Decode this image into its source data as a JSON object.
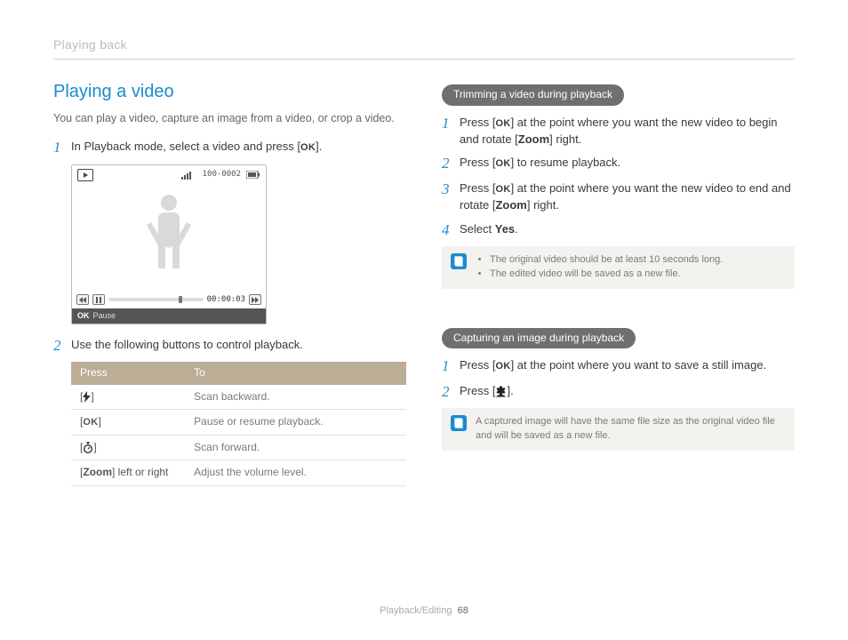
{
  "header": {
    "breadcrumb": "Playing back"
  },
  "left": {
    "title": "Playing a video",
    "lead": "You can play a video, capture an image from a video, or crop a video.",
    "step1_pre": "In Playback mode, select a video and press [",
    "step1_post": "].",
    "screenshot": {
      "top_counter": "100-0002",
      "timecode": "00:00:03",
      "footer_ok": "OK",
      "footer_label": "Pause"
    },
    "step2": "Use the following buttons to control playback.",
    "table": {
      "headers": [
        "Press",
        "To"
      ],
      "rows": [
        {
          "press_open": "[",
          "press_icon": "flash",
          "press_close": "]",
          "to": "Scan backward."
        },
        {
          "press_open": "[",
          "press_icon": "ok",
          "press_close": "]",
          "to": "Pause or resume playback."
        },
        {
          "press_open": "[",
          "press_icon": "timer",
          "press_close": "]",
          "to": "Scan forward."
        },
        {
          "press_plain": "[Zoom] left or right",
          "to": "Adjust the volume level."
        }
      ]
    }
  },
  "right": {
    "trim_pill": "Trimming a video during playback",
    "trim_steps": {
      "s1_a": "Press [",
      "s1_b": "] at the point where you want the new video to begin and rotate [",
      "s1_zoom": "Zoom",
      "s1_c": "] right.",
      "s2_a": "Press [",
      "s2_b": "] to resume playback.",
      "s3_a": "Press [",
      "s3_b": "] at the point where you want the new video to end and rotate [",
      "s3_zoom": "Zoom",
      "s3_c": "] right.",
      "s4_a": "Select ",
      "s4_yes": "Yes",
      "s4_b": "."
    },
    "trim_tip": [
      "The original video should be at least 10 seconds long.",
      "The edited video will be saved as a new file."
    ],
    "cap_pill": "Capturing an image during playback",
    "cap_steps": {
      "s1_a": "Press [",
      "s1_b": "] at the point where you want to save a still image.",
      "s2_a": "Press [",
      "s2_b": "]."
    },
    "cap_tip": "A captured image will have the same file size as the original video file and will be saved as a new file."
  },
  "footer": {
    "section": "Playback/Editing",
    "page": "68"
  }
}
